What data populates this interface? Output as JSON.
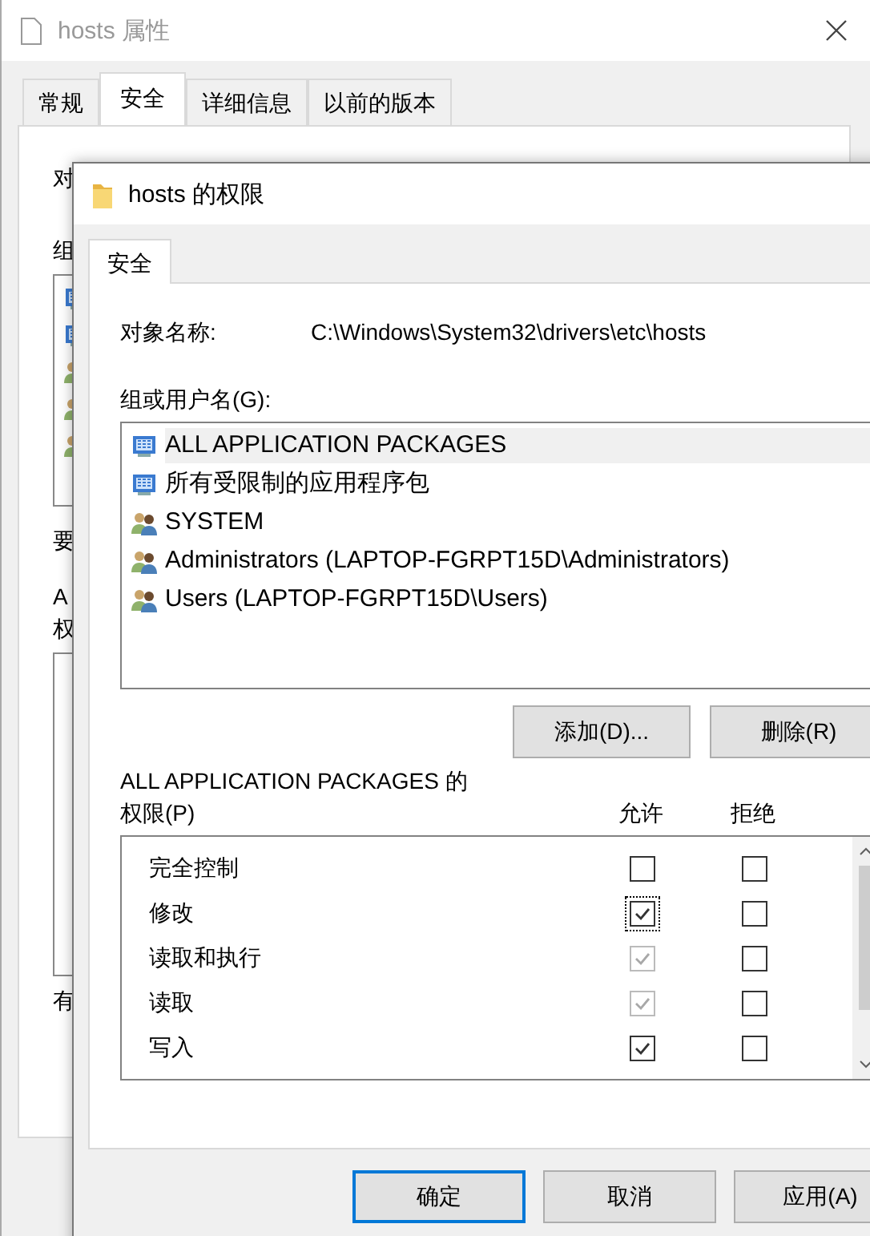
{
  "back_window": {
    "title": "hosts 属性",
    "tabs": [
      {
        "label": "常规",
        "selected": false
      },
      {
        "label": "安全",
        "selected": true
      },
      {
        "label": "详细信息",
        "selected": false
      },
      {
        "label": "以前的版本",
        "selected": false
      }
    ],
    "fragments": [
      {
        "text": "对",
        "kind": "line"
      },
      {
        "text": "组",
        "kind": "line"
      },
      {
        "kind": "list",
        "icons": [
          {
            "kind": "package"
          },
          {
            "kind": "package"
          },
          {
            "kind": "users"
          },
          {
            "kind": "users"
          },
          {
            "kind": "users"
          }
        ]
      },
      {
        "text": "要",
        "kind": "line"
      },
      {
        "text": "A",
        "kind": "line"
      },
      {
        "text": "权",
        "kind": "line"
      },
      {
        "kind": "box"
      },
      {
        "text": "有",
        "kind": "line"
      }
    ]
  },
  "dialog": {
    "title": "hosts 的权限",
    "tabs": [
      {
        "label": "安全",
        "selected": true
      }
    ],
    "object_label": "对象名称:",
    "object_value": "C:\\Windows\\System32\\drivers\\etc\\hosts",
    "groups_label": "组或用户名(G):",
    "principals": [
      {
        "name": "ALL APPLICATION PACKAGES",
        "kind": "package",
        "selected": true
      },
      {
        "name": "所有受限制的应用程序包",
        "kind": "package",
        "selected": false
      },
      {
        "name": "SYSTEM",
        "kind": "users",
        "selected": false
      },
      {
        "name": "Administrators (LAPTOP-FGRPT15D\\Administrators)",
        "kind": "users",
        "selected": false
      },
      {
        "name": "Users (LAPTOP-FGRPT15D\\Users)",
        "kind": "users",
        "selected": false
      }
    ],
    "list_buttons": [
      "添加(D)...",
      "删除(R)"
    ],
    "permissions_title": "ALL APPLICATION PACKAGES 的",
    "permissions_label": "权限(P)",
    "columns": [
      "允许",
      "拒绝"
    ],
    "permissions": [
      {
        "name": "完全控制",
        "allow": {
          "checked": false,
          "disabled": false,
          "focused": false
        },
        "deny": {
          "checked": false,
          "disabled": false
        }
      },
      {
        "name": "修改",
        "allow": {
          "checked": true,
          "disabled": false,
          "focused": true
        },
        "deny": {
          "checked": false,
          "disabled": false
        }
      },
      {
        "name": "读取和执行",
        "allow": {
          "checked": true,
          "disabled": true,
          "focused": false
        },
        "deny": {
          "checked": false,
          "disabled": false
        }
      },
      {
        "name": "读取",
        "allow": {
          "checked": true,
          "disabled": true,
          "focused": false
        },
        "deny": {
          "checked": false,
          "disabled": false
        }
      },
      {
        "name": "写入",
        "allow": {
          "checked": true,
          "disabled": false,
          "focused": false
        },
        "deny": {
          "checked": false,
          "disabled": false
        }
      }
    ],
    "footer_buttons": [
      {
        "label": "确定",
        "default": true
      },
      {
        "label": "取消",
        "default": false
      },
      {
        "label": "应用(A)",
        "default": false
      }
    ]
  }
}
